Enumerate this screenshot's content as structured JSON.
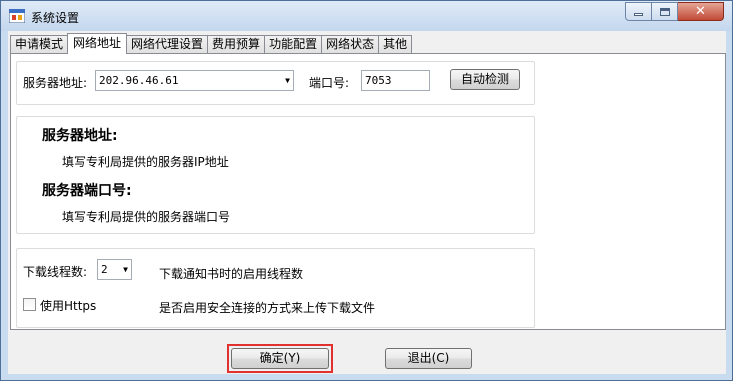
{
  "window": {
    "title": "系统设置",
    "icons": {
      "app": "app-window-icon",
      "minimize": "minimize-icon",
      "maximize": "maximize-icon",
      "close": "close-icon"
    }
  },
  "tabs": [
    {
      "label": "申请模式",
      "active": false
    },
    {
      "label": "网络地址",
      "active": true
    },
    {
      "label": "网络代理设置",
      "active": false
    },
    {
      "label": "费用预算",
      "active": false
    },
    {
      "label": "功能配置",
      "active": false
    },
    {
      "label": "网络状态",
      "active": false
    },
    {
      "label": "其他",
      "active": false
    }
  ],
  "server": {
    "address_label": "服务器地址:",
    "address_value": "202.96.46.61",
    "port_label": "端口号:",
    "port_value": "7053",
    "autodetect_label": "自动检测"
  },
  "help": {
    "address_title": "服务器地址:",
    "address_desc": "填写专利局提供的服务器IP地址",
    "port_title": "服务器端口号:",
    "port_desc": "填写专利局提供的服务器端口号"
  },
  "download": {
    "threads_label": "下载线程数:",
    "threads_value": "2",
    "threads_desc": "下载通知书时的启用线程数",
    "https_label": "使用Https",
    "https_checked": false,
    "https_desc": "是否启用安全连接的方式来上传下载文件"
  },
  "footer": {
    "ok_label": "确定(Y)",
    "exit_label": "退出(C)"
  }
}
